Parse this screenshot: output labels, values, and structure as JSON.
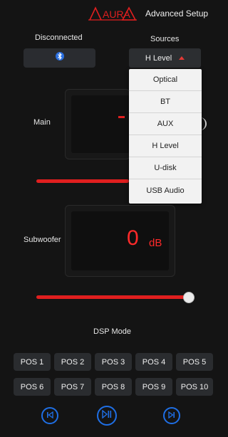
{
  "header": {
    "logo_text": "AURA",
    "title": "Advanced Setup"
  },
  "connection": {
    "status": "Disconnected",
    "bt_icon": "bluetooth-icon"
  },
  "sources": {
    "label": "Sources",
    "selected": "H Level",
    "options": [
      "Optical",
      "BT",
      "AUX",
      "H Level",
      "U-disk",
      "USB Audio"
    ]
  },
  "main": {
    "label": "Main",
    "value_visible": "-",
    "slider_level_pct": 60
  },
  "subwoofer": {
    "label": "Subwoofer",
    "value": "0",
    "unit": "dB",
    "slider_level_pct": 100
  },
  "dsp": {
    "label": "DSP Mode",
    "presets": [
      "POS 1",
      "POS 2",
      "POS 3",
      "POS 4",
      "POS 5",
      "POS 6",
      "POS 7",
      "POS 8",
      "POS 9",
      "POS 10"
    ]
  },
  "controls": {
    "prev_icon": "skip-previous-icon",
    "play_icon": "play-pause-icon",
    "next_icon": "skip-next-icon"
  },
  "colors": {
    "accent_red": "#e01f1f",
    "accent_blue": "#1f6fe5",
    "background": "#141414"
  }
}
